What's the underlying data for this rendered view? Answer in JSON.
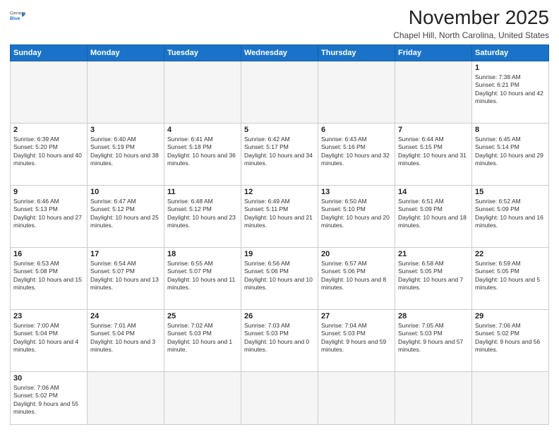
{
  "header": {
    "logo_general": "General",
    "logo_blue": "Blue",
    "month_title": "November 2025",
    "subtitle": "Chapel Hill, North Carolina, United States"
  },
  "days_of_week": [
    "Sunday",
    "Monday",
    "Tuesday",
    "Wednesday",
    "Thursday",
    "Friday",
    "Saturday"
  ],
  "weeks": [
    [
      {
        "day": "",
        "empty": true
      },
      {
        "day": "",
        "empty": true
      },
      {
        "day": "",
        "empty": true
      },
      {
        "day": "",
        "empty": true
      },
      {
        "day": "",
        "empty": true
      },
      {
        "day": "",
        "empty": true
      },
      {
        "day": "1",
        "sunrise": "7:38 AM",
        "sunset": "6:21 PM",
        "daylight": "10 hours and 42 minutes."
      }
    ],
    [
      {
        "day": "2",
        "sunrise": "6:39 AM",
        "sunset": "5:20 PM",
        "daylight": "10 hours and 40 minutes."
      },
      {
        "day": "3",
        "sunrise": "6:40 AM",
        "sunset": "5:19 PM",
        "daylight": "10 hours and 38 minutes."
      },
      {
        "day": "4",
        "sunrise": "6:41 AM",
        "sunset": "5:18 PM",
        "daylight": "10 hours and 36 minutes."
      },
      {
        "day": "5",
        "sunrise": "6:42 AM",
        "sunset": "5:17 PM",
        "daylight": "10 hours and 34 minutes."
      },
      {
        "day": "6",
        "sunrise": "6:43 AM",
        "sunset": "5:16 PM",
        "daylight": "10 hours and 32 minutes."
      },
      {
        "day": "7",
        "sunrise": "6:44 AM",
        "sunset": "5:15 PM",
        "daylight": "10 hours and 31 minutes."
      },
      {
        "day": "8",
        "sunrise": "6:45 AM",
        "sunset": "5:14 PM",
        "daylight": "10 hours and 29 minutes."
      }
    ],
    [
      {
        "day": "9",
        "sunrise": "6:46 AM",
        "sunset": "5:13 PM",
        "daylight": "10 hours and 27 minutes."
      },
      {
        "day": "10",
        "sunrise": "6:47 AM",
        "sunset": "5:12 PM",
        "daylight": "10 hours and 25 minutes."
      },
      {
        "day": "11",
        "sunrise": "6:48 AM",
        "sunset": "5:12 PM",
        "daylight": "10 hours and 23 minutes."
      },
      {
        "day": "12",
        "sunrise": "6:49 AM",
        "sunset": "5:11 PM",
        "daylight": "10 hours and 21 minutes."
      },
      {
        "day": "13",
        "sunrise": "6:50 AM",
        "sunset": "5:10 PM",
        "daylight": "10 hours and 20 minutes."
      },
      {
        "day": "14",
        "sunrise": "6:51 AM",
        "sunset": "5:09 PM",
        "daylight": "10 hours and 18 minutes."
      },
      {
        "day": "15",
        "sunrise": "6:52 AM",
        "sunset": "5:09 PM",
        "daylight": "10 hours and 16 minutes."
      }
    ],
    [
      {
        "day": "16",
        "sunrise": "6:53 AM",
        "sunset": "5:08 PM",
        "daylight": "10 hours and 15 minutes."
      },
      {
        "day": "17",
        "sunrise": "6:54 AM",
        "sunset": "5:07 PM",
        "daylight": "10 hours and 13 minutes."
      },
      {
        "day": "18",
        "sunrise": "6:55 AM",
        "sunset": "5:07 PM",
        "daylight": "10 hours and 11 minutes."
      },
      {
        "day": "19",
        "sunrise": "6:56 AM",
        "sunset": "5:06 PM",
        "daylight": "10 hours and 10 minutes."
      },
      {
        "day": "20",
        "sunrise": "6:57 AM",
        "sunset": "5:06 PM",
        "daylight": "10 hours and 8 minutes."
      },
      {
        "day": "21",
        "sunrise": "6:58 AM",
        "sunset": "5:05 PM",
        "daylight": "10 hours and 7 minutes."
      },
      {
        "day": "22",
        "sunrise": "6:59 AM",
        "sunset": "5:05 PM",
        "daylight": "10 hours and 5 minutes."
      }
    ],
    [
      {
        "day": "23",
        "sunrise": "7:00 AM",
        "sunset": "5:04 PM",
        "daylight": "10 hours and 4 minutes."
      },
      {
        "day": "24",
        "sunrise": "7:01 AM",
        "sunset": "5:04 PM",
        "daylight": "10 hours and 3 minutes."
      },
      {
        "day": "25",
        "sunrise": "7:02 AM",
        "sunset": "5:03 PM",
        "daylight": "10 hours and 1 minute."
      },
      {
        "day": "26",
        "sunrise": "7:03 AM",
        "sunset": "5:03 PM",
        "daylight": "10 hours and 0 minutes."
      },
      {
        "day": "27",
        "sunrise": "7:04 AM",
        "sunset": "5:03 PM",
        "daylight": "9 hours and 59 minutes."
      },
      {
        "day": "28",
        "sunrise": "7:05 AM",
        "sunset": "5:03 PM",
        "daylight": "9 hours and 57 minutes."
      },
      {
        "day": "29",
        "sunrise": "7:06 AM",
        "sunset": "5:02 PM",
        "daylight": "9 hours and 56 minutes."
      }
    ],
    [
      {
        "day": "30",
        "sunrise": "7:06 AM",
        "sunset": "5:02 PM",
        "daylight": "9 hours and 55 minutes."
      },
      {
        "day": "",
        "empty": true
      },
      {
        "day": "",
        "empty": true
      },
      {
        "day": "",
        "empty": true
      },
      {
        "day": "",
        "empty": true
      },
      {
        "day": "",
        "empty": true
      },
      {
        "day": "",
        "empty": true
      }
    ]
  ]
}
